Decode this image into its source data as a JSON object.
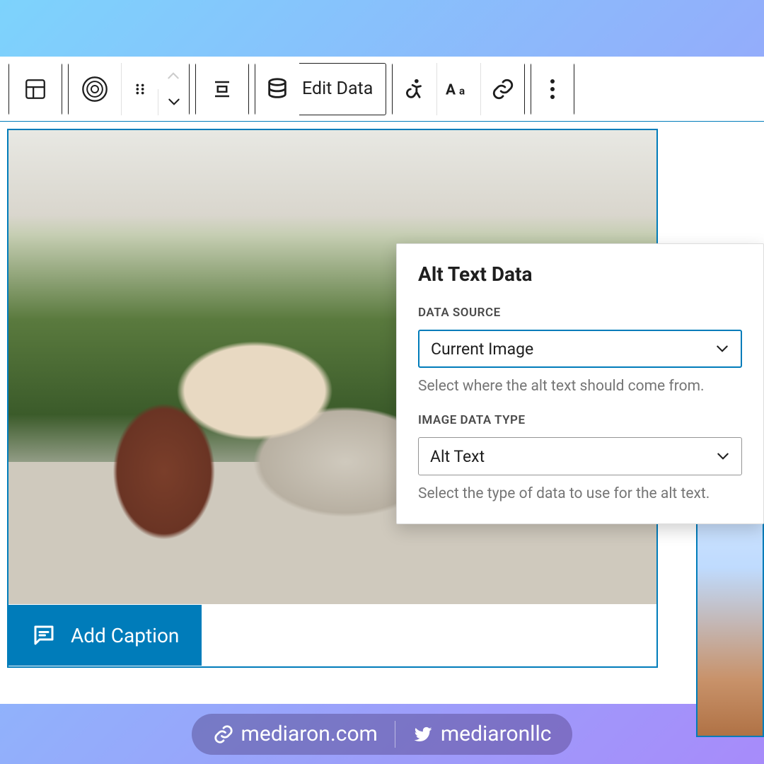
{
  "toolbar": {
    "edit_data_label": "Edit Data"
  },
  "popover": {
    "title": "Alt Text Data",
    "data_source": {
      "label": "DATA SOURCE",
      "selected": "Current Image",
      "help": "Select where the alt text should come from."
    },
    "image_data_type": {
      "label": "IMAGE DATA TYPE",
      "selected": "Alt Text",
      "help": "Select the type of data to use for the alt text."
    }
  },
  "caption": {
    "add_label": "Add Caption"
  },
  "footer": {
    "site": "mediaron.com",
    "twitter": "mediaronllc"
  }
}
